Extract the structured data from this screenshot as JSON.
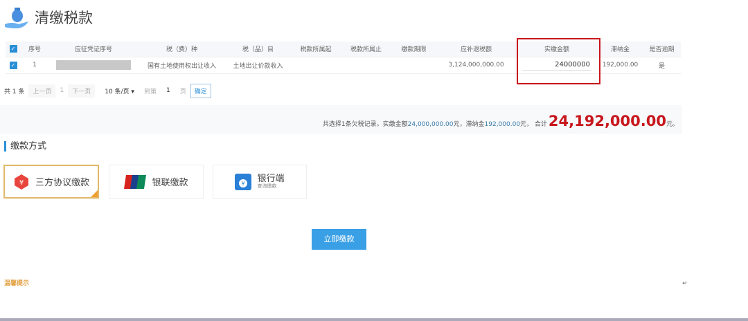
{
  "header": {
    "title": "清缴税款",
    "icon": "money-bag-hand-icon"
  },
  "table": {
    "headers": [
      "序号",
      "应征凭证序号",
      "税（费）种",
      "税（品）目",
      "税款所属起",
      "税款所属止",
      "缴款期限",
      "应补退税额",
      "实缴金额",
      "滞纳金",
      "是否逾期"
    ],
    "rows": [
      {
        "index": "1",
        "voucher": "",
        "tax_type": "国有土地使用权出让收入",
        "tax_item": "土地出让价款收入",
        "period_start": "",
        "period_end": "",
        "deadline": "",
        "due": "3,124,000,000.00",
        "paid": "24000000",
        "late_fee": "192,000.00",
        "overdue": "是"
      }
    ]
  },
  "pager": {
    "total": "共 1 条",
    "prev": "上一页",
    "page": "1",
    "next": "下一页",
    "per_page": "10 条/页 ▾",
    "goto": "到第",
    "goto_value": "1",
    "page_unit": "页",
    "confirm": "确定"
  },
  "summary": {
    "prefix": "共选择1条欠税记录。实缴金额",
    "paid": "24,000,000.00",
    "mid1": " 元，滞纳金 ",
    "late": "192,000.00",
    "mid2": "元， 合计",
    "total": "24,192,000.00",
    "suffix": "元。"
  },
  "section": {
    "title": "缴款方式"
  },
  "methods": [
    {
      "label": "三方协议缴款",
      "icon": "tripartite-icon"
    },
    {
      "label": "银联缴款",
      "icon": "unionpay-icon"
    },
    {
      "label": "银行端",
      "sub": "查询缴款",
      "icon": "bank-bag-icon"
    }
  ],
  "pay_button": "立即缴款",
  "tip": "温馨提示",
  "colors": {
    "accent": "#2a8fd6",
    "highlight": "#c8161d"
  }
}
